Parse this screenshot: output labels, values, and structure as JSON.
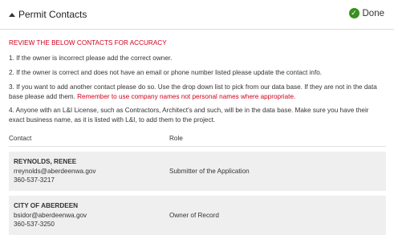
{
  "header": {
    "title": "Permit Contacts",
    "status_label": "Done",
    "status_color": "#3a8f1e",
    "toggle_icon": "caret-up-icon",
    "status_icon": "check-circle-icon"
  },
  "instructions": {
    "heading": "REVIEW THE BELOW CONTACTS FOR ACCURACY",
    "item1": "1. If the owner is incorrect please add the correct owner.",
    "item2": "2. If the owner is correct and does not have an email or phone number listed please update the contact info.",
    "item3": "3. If you want to add another contact please do so.  Use the drop down list to pick from our data base. If they are not in the data base please add them.",
    "item3_note": "Remember to use company names not personal names where appropriate.",
    "item4": "4. Anyone with an L&I License, such as Contractors, Architect's and such, will be in the data base. Make sure you have their exact business name, as it is listed with L&I, to add them to the project."
  },
  "table": {
    "columns": [
      "Contact",
      "Role"
    ],
    "rows": [
      {
        "name": "REYNOLDS, RENEE",
        "email": "rreynolds@aberdeenwa.gov",
        "phone": "360-537-3217",
        "role": "Submitter of the Application"
      },
      {
        "name": "CITY OF ABERDEEN",
        "email": "bsidor@aberdeenwa.gov",
        "phone": "360-537-3250",
        "role": "Owner of Record"
      }
    ]
  }
}
